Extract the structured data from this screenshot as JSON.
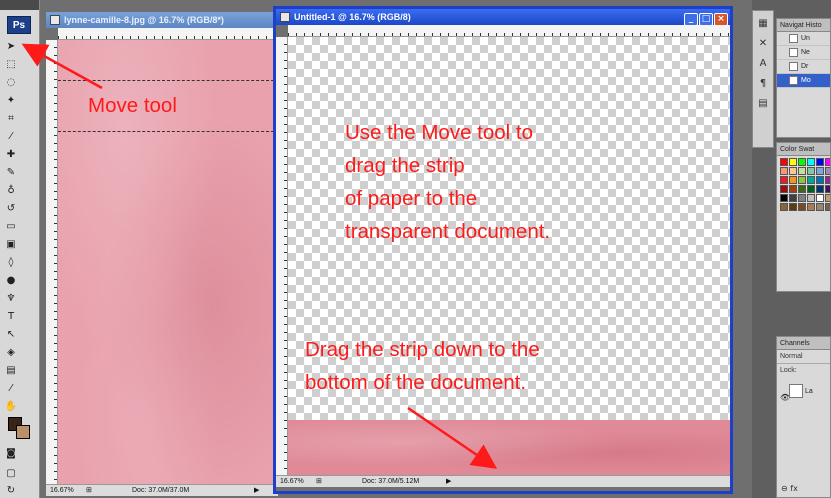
{
  "app": {
    "logo": "Ps"
  },
  "doc1": {
    "title": "lynne-camille-8.jpg @ 16.7% (RGB/8*)",
    "zoom": "16.67%",
    "doc_size": "Doc: 37.0M/37.0M"
  },
  "doc2": {
    "title": "Untitled-1 @ 16.7% (RGB/8)",
    "zoom": "16.67%",
    "doc_size": "Doc: 37.0M/5.12M",
    "btn_min": "_",
    "btn_max": "□",
    "btn_close": "×"
  },
  "annotations": {
    "move_tool": "Move tool",
    "instruction_lines": [
      "Use the Move tool to",
      "drag the strip",
      "of paper to the",
      "transparent document."
    ],
    "drag_lines": [
      "Drag the strip down to the",
      "bottom of the document."
    ]
  },
  "panels": {
    "history_tab": "Navigat Histo",
    "history_items": [
      "Un",
      "Ne",
      "Dr",
      "Mo"
    ],
    "swatches_tab": "Color Swat",
    "layers_tab": "Channels",
    "layers_mode": "Normal",
    "layers_lock": "Lock:",
    "layer_name": "La"
  },
  "colors": {
    "annotation": "#ff1a1a",
    "paper_pink": "#e8a1ad",
    "active_window_border": "#1e3fc8",
    "foreground": "#3a2418",
    "background": "#b9906a"
  },
  "icons": {
    "move": "move-tool-icon",
    "marquee": "marquee-tool-icon",
    "lasso": "lasso-tool-icon",
    "magic_wand": "magic-wand-icon",
    "crop": "crop-tool-icon",
    "eyedropper": "eyedropper-icon"
  }
}
